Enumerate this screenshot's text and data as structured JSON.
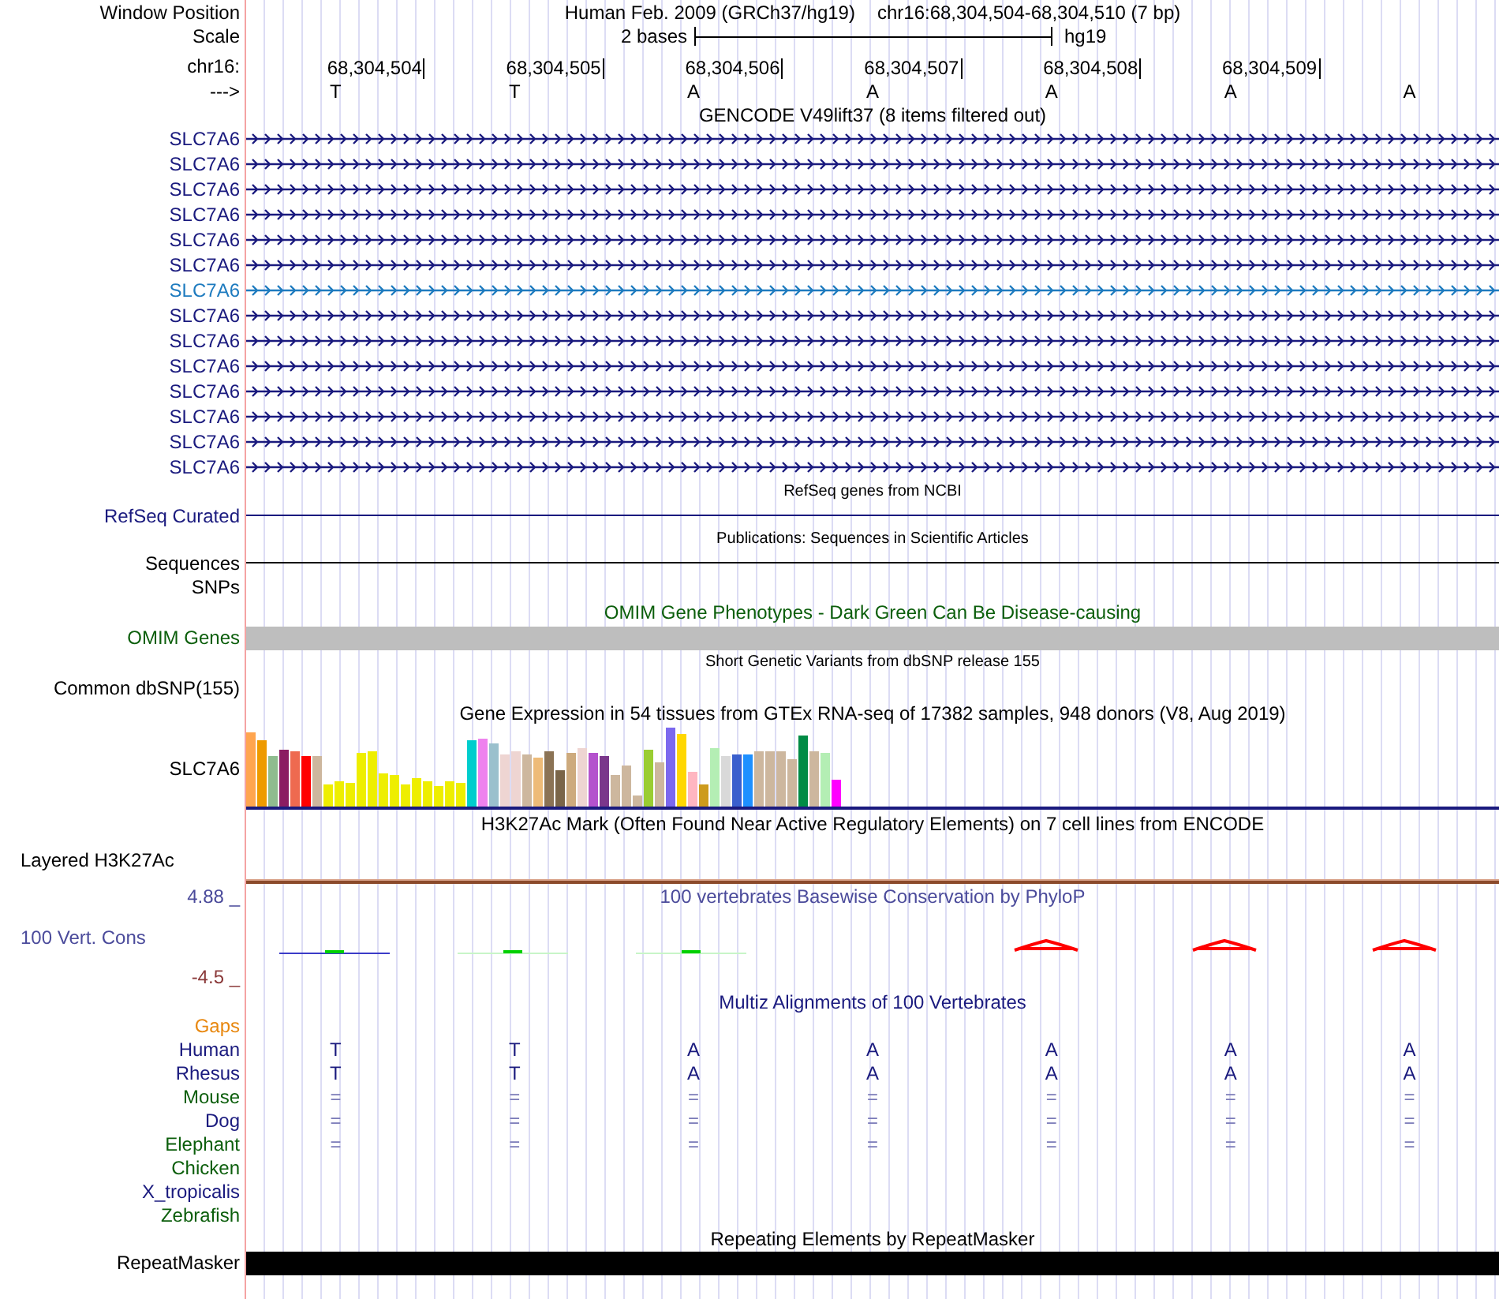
{
  "ruler": {
    "position_label": "Window Position",
    "title": "Human Feb. 2009 (GRCh37/hg19)",
    "range": "chr16:68,304,504-68,304,510 (7 bp)",
    "scale_label": "Scale",
    "scale_text": "2 bases",
    "assembly": "hg19",
    "chrom_label": "chr16:",
    "strand_label": "--->",
    "positions": [
      "68,304,504",
      "68,304,505",
      "68,304,506",
      "68,304,507",
      "68,304,508",
      "68,304,509"
    ],
    "bases": [
      "T",
      "T",
      "A",
      "A",
      "A",
      "A",
      "A"
    ]
  },
  "tracks": [
    {
      "kind": "genes",
      "title": "GENCODE V49lift37 (8 items filtered out)",
      "items": [
        {
          "label": "SLC7A6",
          "color": "#1a1a7e"
        },
        {
          "label": "SLC7A6",
          "color": "#1a1a7e"
        },
        {
          "label": "SLC7A6",
          "color": "#1a1a7e"
        },
        {
          "label": "SLC7A6",
          "color": "#1a1a7e"
        },
        {
          "label": "SLC7A6",
          "color": "#1a1a7e"
        },
        {
          "label": "SLC7A6",
          "color": "#1a1a7e"
        },
        {
          "label": "SLC7A6",
          "color": "#1e7bbf"
        },
        {
          "label": "SLC7A6",
          "color": "#1a1a7e"
        },
        {
          "label": "SLC7A6",
          "color": "#1a1a7e"
        },
        {
          "label": "SLC7A6",
          "color": "#1a1a7e"
        },
        {
          "label": "SLC7A6",
          "color": "#1a1a7e"
        },
        {
          "label": "SLC7A6",
          "color": "#1a1a7e"
        },
        {
          "label": "SLC7A6",
          "color": "#1a1a7e"
        },
        {
          "label": "SLC7A6",
          "color": "#1a1a7e"
        }
      ]
    },
    {
      "kind": "line",
      "title": "RefSeq genes from NCBI",
      "label": "RefSeq Curated",
      "color": "#1a1a7e"
    },
    {
      "kind": "line",
      "title": "Publications: Sequences in Scientific Articles",
      "label": "Sequences",
      "color": "#000000"
    },
    {
      "kind": "label",
      "label": "SNPs",
      "color": "#000000"
    },
    {
      "kind": "shade",
      "heading": {
        "text": "OMIM Gene Phenotypes - Dark Green Can Be Disease-causing",
        "color": "#0b5e0b"
      },
      "label": "OMIM Genes",
      "color": "#0b5e0b"
    },
    {
      "kind": "variants",
      "title": "Short Genetic Variants from dbSNP release 155",
      "label": "Common dbSNP(155)",
      "color": "#000000"
    },
    {
      "kind": "expression",
      "title": "Gene Expression in 54 tissues from GTEx RNA-seq of 17382 samples, 948 donors (V8, Aug 2019)",
      "label": "SLC7A6",
      "color": "#000000"
    },
    {
      "kind": "layered",
      "title": "H3K27Ac Mark (Often Found Near Active Regulatory Elements) on 7 cell lines from ENCODE",
      "label": "Layered H3K27Ac",
      "color": "#000000"
    },
    {
      "kind": "wiggle",
      "heading": {
        "text": "100 vertebrates Basewise Conservation by PhyloP",
        "color": "#4b4b9b"
      },
      "label": "100 Vert. Cons",
      "color": "#4b4b9b",
      "y_max": "4.88 _",
      "y_min": "-4.5 _"
    },
    {
      "kind": "alignment",
      "heading": {
        "text": "Multiz Alignments of 100 Vertebrates",
        "color": "#1a1a7e"
      },
      "species": [
        {
          "label": "Gaps",
          "color": "#e8870e",
          "kind": "none"
        },
        {
          "label": "Human",
          "color": "#1a1a7e",
          "kind": "bases",
          "bases": [
            "T",
            "T",
            "A",
            "A",
            "A",
            "A",
            "A"
          ]
        },
        {
          "label": "Rhesus",
          "color": "#1a1a7e",
          "kind": "bases",
          "bases": [
            "T",
            "T",
            "A",
            "A",
            "A",
            "A",
            "A"
          ]
        },
        {
          "label": "Mouse",
          "color": "#0b5e0b",
          "kind": "match",
          "bases": [
            "=",
            "=",
            "=",
            "=",
            "=",
            "=",
            "="
          ]
        },
        {
          "label": "Dog",
          "color": "#1a1a7e",
          "kind": "match",
          "bases": [
            "=",
            "=",
            "=",
            "=",
            "=",
            "=",
            "="
          ]
        },
        {
          "label": "Elephant",
          "color": "#0b5e0b",
          "kind": "match",
          "bases": [
            "=",
            "=",
            "=",
            "=",
            "=",
            "=",
            "="
          ]
        },
        {
          "label": "Chicken",
          "color": "#0b5e0b",
          "kind": "none"
        },
        {
          "label": "X_tropicalis",
          "color": "#1a1a7e",
          "kind": "none"
        },
        {
          "label": "Zebrafish",
          "color": "#0b5e0b",
          "kind": "none"
        }
      ]
    },
    {
      "kind": "block",
      "title": "Repeating Elements by RepeatMasker",
      "label": "RepeatMasker",
      "color": "#000000"
    }
  ]
}
